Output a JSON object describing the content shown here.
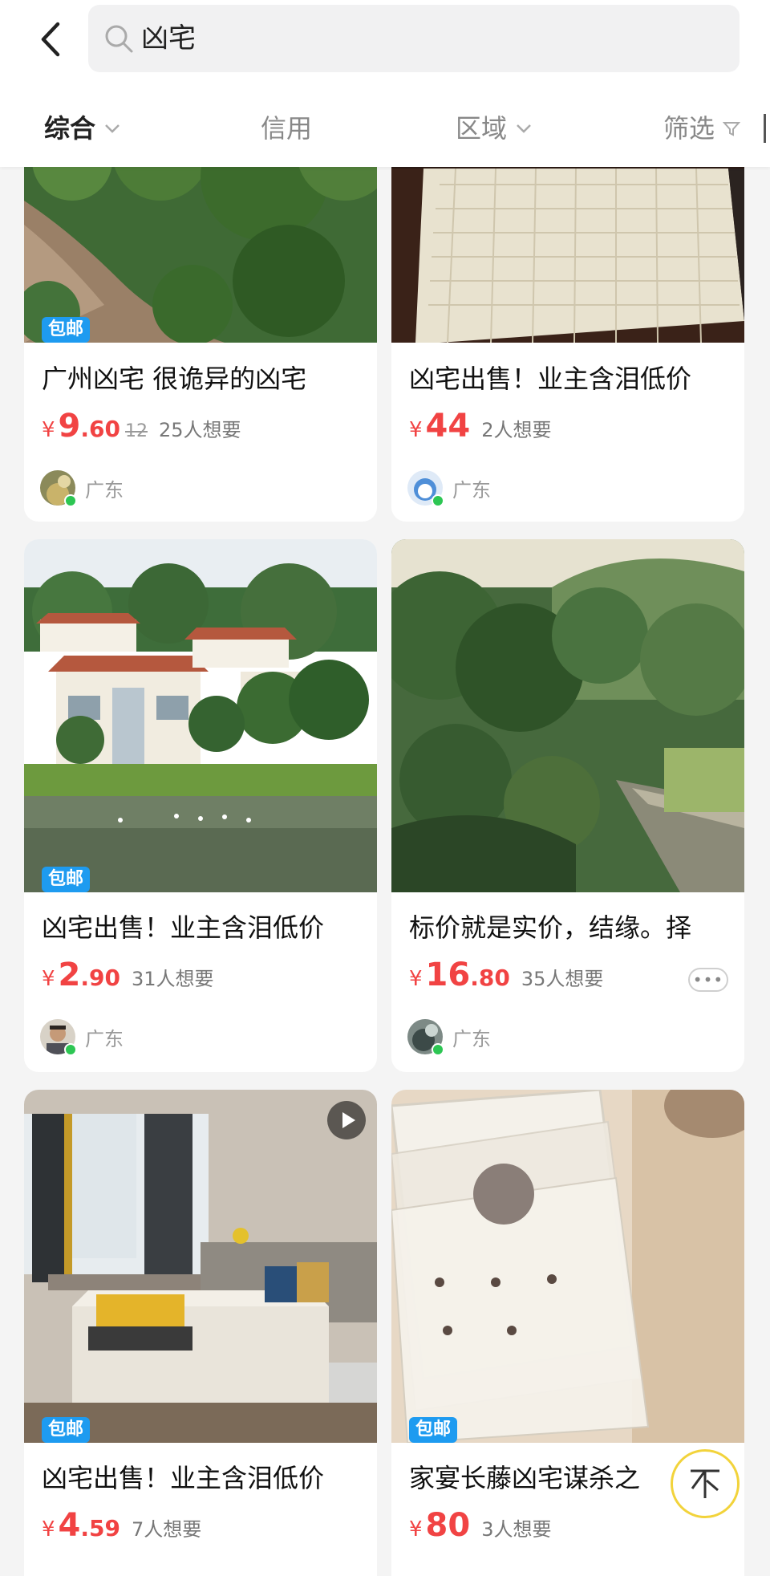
{
  "search": {
    "query": "凶宅"
  },
  "tabs": [
    {
      "label": "综合"
    },
    {
      "label": "信用"
    },
    {
      "label": "区域"
    },
    {
      "label": "筛选"
    }
  ],
  "colors": {
    "price": "#f14343",
    "badge": "#1e9bf0",
    "online": "#2dc653",
    "to_top_ring": "#f2d33b"
  },
  "items": [
    {
      "badge": "包邮",
      "title": "广州凶宅 很诡异的凶宅",
      "price_int": "9",
      "price_dec": ".60",
      "orig_price": "12",
      "wants": "25人想要",
      "location": "广东",
      "image": "river-forest"
    },
    {
      "badge": "",
      "title": "凶宅出售！业主含泪低价",
      "price_int": "44",
      "price_dec": "",
      "orig_price": "",
      "wants": "2人想要",
      "location": "广东",
      "image": "mattress"
    },
    {
      "badge": "包邮",
      "title": "凶宅出售！业主含泪低价",
      "price_int": "2",
      "price_dec": ".90",
      "orig_price": "",
      "wants": "31人想要",
      "location": "广东",
      "image": "villa-lake"
    },
    {
      "badge": "",
      "title": "标价就是实价，结缘。择",
      "price_int": "16",
      "price_dec": ".80",
      "orig_price": "",
      "wants": "35人想要",
      "location": "广东",
      "image": "mountain-path",
      "more": "•••"
    },
    {
      "badge": "包邮",
      "title": "凶宅出售！业主含泪低价",
      "price_int": "4",
      "price_dec": ".59",
      "orig_price": "",
      "wants": "7人想要",
      "location": "",
      "image": "bedroom",
      "video": true
    },
    {
      "badge": "包邮",
      "title": "家宴长藤凶宅谋杀之",
      "price_int": "80",
      "price_dec": "",
      "orig_price": "",
      "wants": "3人想要",
      "location": "",
      "image": "cards"
    }
  ],
  "currency": "¥",
  "to_top": {
    "icon": "to-top-icon"
  }
}
